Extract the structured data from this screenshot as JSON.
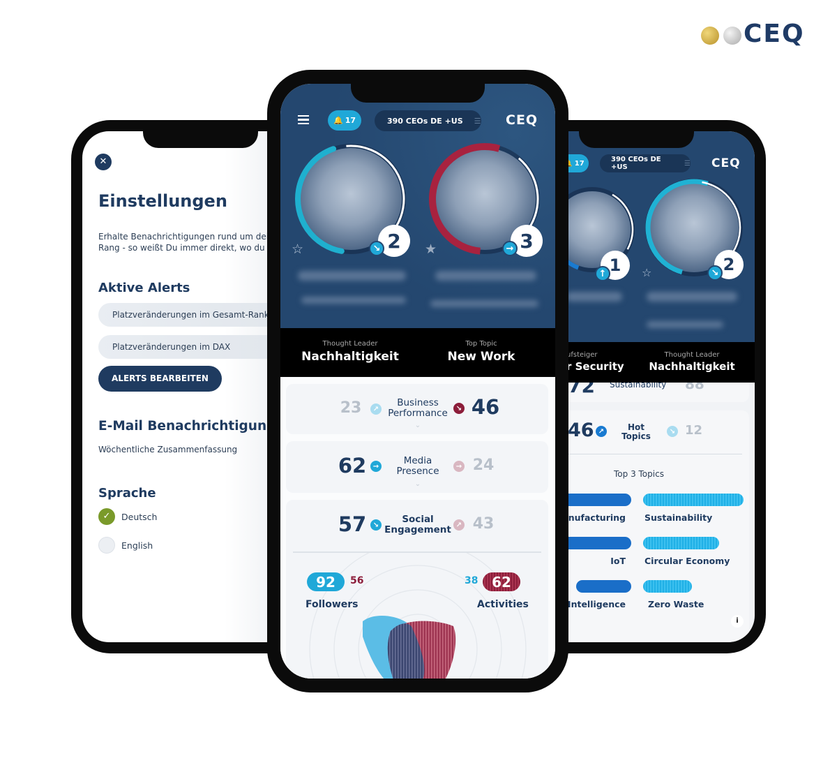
{
  "brand": {
    "logo_text": "CEQ",
    "colors": {
      "navy": "#1f3b60",
      "header_blue": "#24476f",
      "cyan": "#20a8d8",
      "crimson": "#8c1d3a",
      "gold": "#c8a53a",
      "silver": "#c9c9c9",
      "green": "#7a9a2a"
    }
  },
  "settings_screen": {
    "close_icon": "close-icon",
    "title": "Einstellungen",
    "description_line1": "Erhalte Benachrichtigungen rund um deinen",
    "description_line2": "Rang - so weißt Du immer direkt, wo du stehst",
    "alerts_heading": "Aktive Alerts",
    "alerts": [
      "Platzveränderungen im Gesamt-Ranking",
      "Platzveränderungen im DAX"
    ],
    "edit_alerts_button": "ALERTS BEARBEITEN",
    "email_heading": "E-Mail Benachrichtigungen",
    "email_option": "Wöchentliche Zusammenfassung",
    "language_heading": "Sprache",
    "languages": [
      {
        "label": "Deutsch",
        "selected": true
      },
      {
        "label": "English",
        "selected": false
      }
    ]
  },
  "compare_screen": {
    "notifications_count": "17",
    "filter_label": "390 CEOs DE +US",
    "logo": "CEQ",
    "profiles": [
      {
        "rank": "2",
        "trend": "down-right",
        "favorite": false
      },
      {
        "rank": "3",
        "trend": "right",
        "favorite": true
      }
    ],
    "highlights": [
      {
        "caption": "Thought Leader",
        "value": "Nachhaltigkeit"
      },
      {
        "caption": "Top Topic",
        "value": "New Work"
      }
    ],
    "metrics": [
      {
        "label_line1": "Business",
        "label_line2": "Performance",
        "left": "23",
        "right": "46",
        "leader": "right"
      },
      {
        "label_line1": "Media",
        "label_line2": "Presence",
        "left": "62",
        "right": "24",
        "leader": "left"
      },
      {
        "label_line1": "Social",
        "label_line2": "Engagement",
        "left": "57",
        "right": "43",
        "leader": "left"
      }
    ],
    "social": {
      "followers_label": "Followers",
      "followers_left": "92",
      "followers_right": "56",
      "activities_label": "Activities",
      "activities_left": "38",
      "activities_right": "62"
    }
  },
  "topics_screen": {
    "notifications_count": "17",
    "filter_label": "390 CEOs DE +US",
    "logo": "CEQ",
    "profiles": [
      {
        "rank": "1",
        "trend": "up"
      },
      {
        "rank": "2",
        "trend": "down-right",
        "favorite": false
      }
    ],
    "highlights": [
      {
        "caption": "ufsteiger",
        "value": "r Security"
      },
      {
        "caption": "Thought Leader",
        "value": "Nachhaltigkeit"
      }
    ],
    "partial_metric": {
      "left": "72",
      "label": "Sustainability",
      "right": "88"
    },
    "hot_topics": {
      "label_line1": "Hot",
      "label_line2": "Topics",
      "left": "46",
      "right": "12"
    },
    "top_topics_heading": "Top 3 Topics",
    "left_topics": [
      "Manufacturing",
      "IoT",
      "al Intelligence"
    ],
    "right_topics": [
      "Sustainability",
      "Circular Economy",
      "Zero Waste"
    ],
    "right_topic_levels": [
      1.0,
      0.75,
      0.48
    ],
    "info_label": "i"
  }
}
